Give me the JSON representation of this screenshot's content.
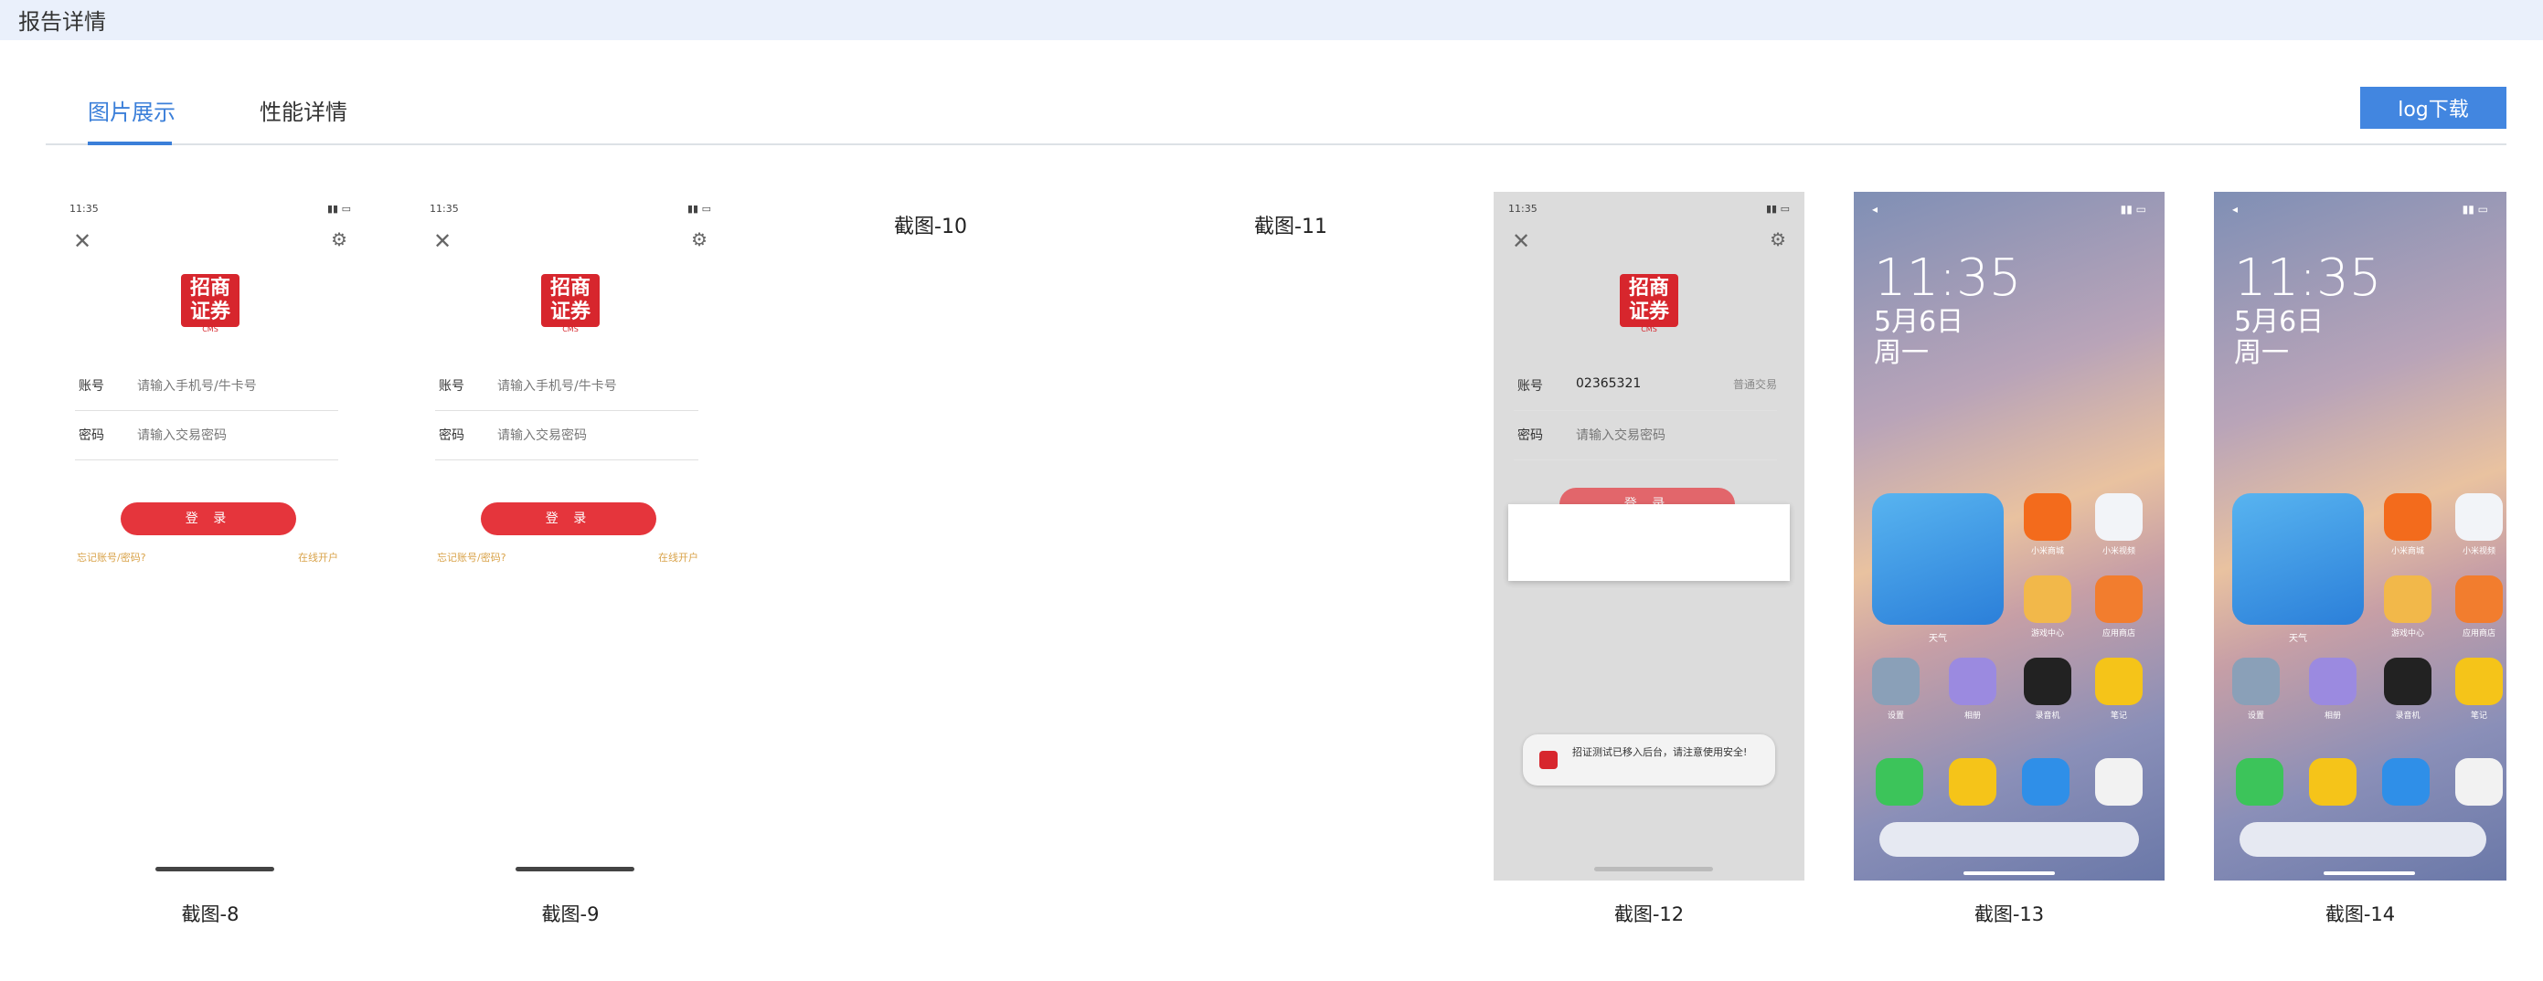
{
  "header": {
    "title": "报告详情"
  },
  "tabs": [
    {
      "label": "图片展示",
      "active": true
    },
    {
      "label": "性能详情",
      "active": false
    }
  ],
  "toolbar": {
    "log_download": "log下载"
  },
  "colors": {
    "accent": "#3b7fd9",
    "button": "#4286e0",
    "brand_red": "#e5353c",
    "topbar": "#eaf0fb"
  },
  "login_screen": {
    "time": "11:35",
    "logo_text": "招商证券",
    "logo_sub": "CMS",
    "account_label": "账号",
    "account_placeholder": "请输入手机号/牛卡号",
    "password_label": "密码",
    "password_placeholder": "请输入交易密码",
    "login_button": "登 录",
    "forgot": "忘记账号/密码?",
    "open_account": "在线开户"
  },
  "login_screen_12": {
    "account_value": "02365321",
    "account_type": "普通交易",
    "toast": "招证测试已移入后台，请注意使用安全!"
  },
  "home_screen": {
    "clock": "11:35",
    "date": "5月6日",
    "weekday": "周一",
    "widget_label": "天气",
    "apps": [
      "小米商城",
      "小米视频",
      "游戏中心",
      "应用商店",
      "设置",
      "相册",
      "录音机",
      "笔记"
    ]
  },
  "screenshots": [
    {
      "caption": "截图-8"
    },
    {
      "caption": "截图-9"
    },
    {
      "caption": "截图-10"
    },
    {
      "caption": "截图-11"
    },
    {
      "caption": "截图-12"
    },
    {
      "caption": "截图-13"
    },
    {
      "caption": "截图-14"
    }
  ]
}
